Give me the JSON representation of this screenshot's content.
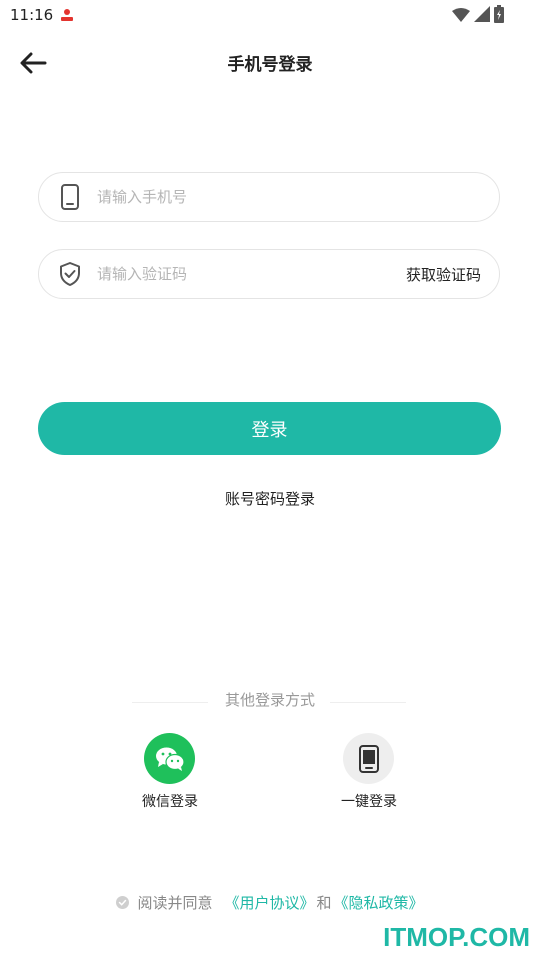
{
  "status_bar": {
    "time": "11:16"
  },
  "header": {
    "title": "手机号登录"
  },
  "phone_field": {
    "placeholder": "请输入手机号",
    "value": ""
  },
  "code_field": {
    "placeholder": "请输入验证码",
    "value": "",
    "get_code_label": "获取验证码"
  },
  "login_button_label": "登录",
  "account_login_label": "账号密码登录",
  "other_login": {
    "label": "其他登录方式",
    "wechat_label": "微信登录",
    "one_click_label": "一键登录"
  },
  "agreement": {
    "prefix": "阅读并同意",
    "user_agreement": "《用户协议》",
    "conjunction": "和",
    "privacy_policy": "《隐私政策》"
  },
  "watermark": "ITMOP.COM",
  "colors": {
    "accent": "#1fb8a6",
    "wechat": "#1fc05b"
  }
}
